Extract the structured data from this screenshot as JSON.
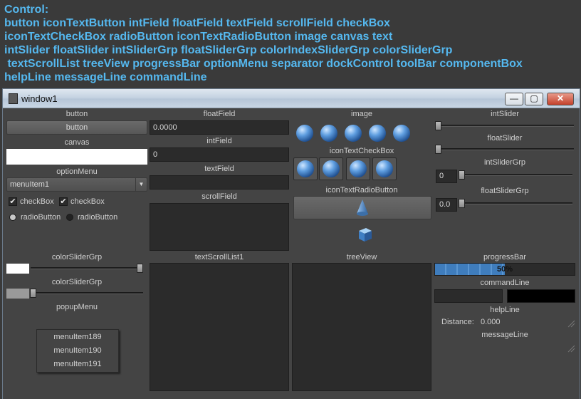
{
  "header": {
    "lines": [
      "Control:",
      "button iconTextButton intField floatField textField scrollField checkBox",
      "iconTextCheckBox radioButton iconTextRadioButton image canvas text",
      "intSlider floatSlider intSliderGrp floatSliderGrp colorIndexSliderGrp colorSliderGrp",
      " textScrollList treeView progressBar optionMenu separator dockControl toolBar componentBox",
      "helpLine messageLine commandLine"
    ],
    "color": "#55b8ef"
  },
  "window": {
    "title": "window1",
    "buttons": {
      "minimize": "—",
      "maximize": "▢",
      "close": "✕"
    }
  },
  "col1": {
    "button_label": "button",
    "button_text": "button",
    "canvas_label": "canvas",
    "canvas_color": "#ffffff",
    "optionmenu_label": "optionMenu",
    "optionmenu_value": "menuItem1",
    "checkbox1": "checkBox",
    "checkbox2": "checkBox",
    "radio1": "radioButton",
    "radio2": "radioButton",
    "colorslidergrp1_label": "colorSliderGrp",
    "colorslidergrp2_label": "colorSliderGrp",
    "popupmenu_label": "popupMenu",
    "popup_items": [
      "menuItem189",
      "menuItem190",
      "menuItem191"
    ]
  },
  "col2": {
    "floatfield_label": "floatField",
    "floatfield_value": "0.0000",
    "intfield_label": "intField",
    "intfield_value": "0",
    "textfield_label": "textField",
    "textfield_value": "",
    "scrollfield_label": "scrollField",
    "textscrolllist_label": "textScrollList1"
  },
  "col3": {
    "image_label": "image",
    "iconTextCheckBox_label": "iconTextCheckBox",
    "iconTextRadioButton_label": "iconTextRadioButton",
    "treeview_label": "treeView",
    "icons": {
      "image": "sphere-icon",
      "radio": "cone-icon",
      "cube": "cube-icon"
    }
  },
  "col4": {
    "intslider_label": "intSlider",
    "floatslider_label": "floatSlider",
    "intslidergrp_label": "intSliderGrp",
    "intslidergrp_value": "0",
    "floatslidergrp_label": "floatSliderGrp",
    "floatslidergrp_value": "0.0",
    "progressbar_label": "progressBar",
    "progressbar_text": "50%",
    "progress_fraction": 0.5,
    "commandline_label": "commandLine",
    "helpline_label": "helpLine",
    "distance_label": "Distance:",
    "distance_value": "0.000",
    "messageline_label": "messageLine"
  }
}
